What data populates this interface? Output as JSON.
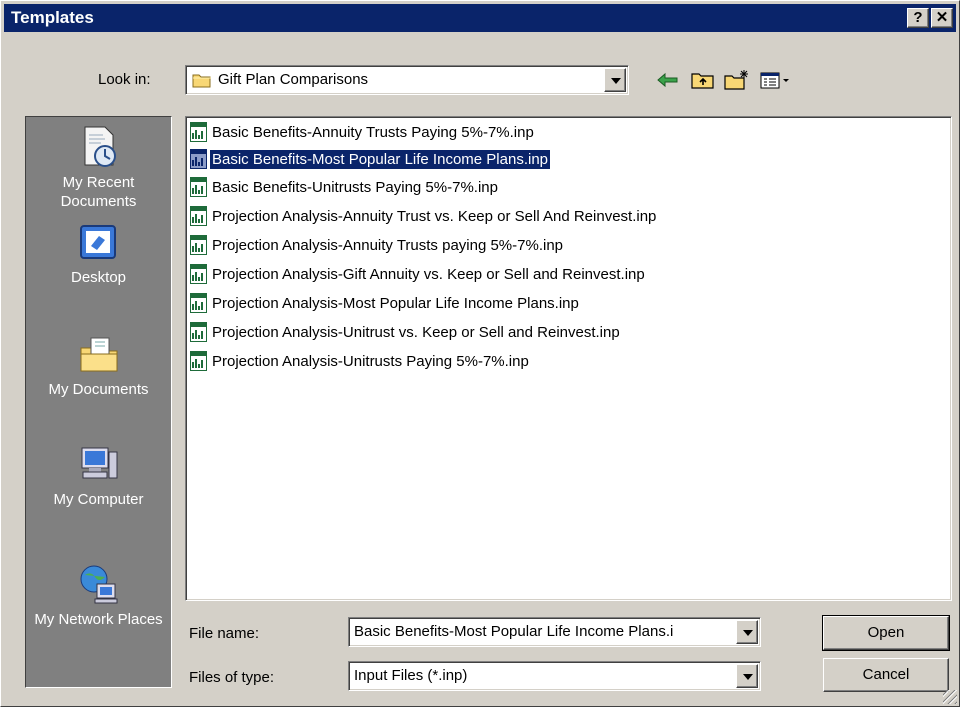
{
  "window": {
    "title": "Templates",
    "help_label": "?",
    "close_label": "✕"
  },
  "look_in": {
    "label": "Look in:",
    "value": "Gift Plan Comparisons"
  },
  "toolbar": {
    "icons": [
      "back-icon",
      "up-folder-icon",
      "new-folder-icon",
      "views-menu-icon"
    ]
  },
  "places": [
    {
      "label": "My Recent Documents",
      "icon": "recent-documents-icon"
    },
    {
      "label": "Desktop",
      "icon": "desktop-icon"
    },
    {
      "label": "My Documents",
      "icon": "my-documents-icon"
    },
    {
      "label": "My Computer",
      "icon": "my-computer-icon"
    },
    {
      "label": "My Network Places",
      "icon": "network-places-icon"
    }
  ],
  "files": [
    {
      "name": "Basic Benefits-Annuity Trusts Paying 5%-7%.inp",
      "selected": false
    },
    {
      "name": "Basic Benefits-Most Popular Life Income Plans.inp",
      "selected": true
    },
    {
      "name": "Basic Benefits-Unitrusts Paying 5%-7%.inp",
      "selected": false
    },
    {
      "name": "Projection Analysis-Annuity Trust vs. Keep or Sell And Reinvest.inp",
      "selected": false
    },
    {
      "name": "Projection Analysis-Annuity Trusts paying 5%-7%.inp",
      "selected": false
    },
    {
      "name": "Projection Analysis-Gift Annuity vs. Keep or Sell and Reinvest.inp",
      "selected": false
    },
    {
      "name": "Projection Analysis-Most Popular Life Income Plans.inp",
      "selected": false
    },
    {
      "name": "Projection Analysis-Unitrust vs. Keep or Sell and Reinvest.inp",
      "selected": false
    },
    {
      "name": "Projection Analysis-Unitrusts Paying 5%-7%.inp",
      "selected": false
    }
  ],
  "file_name": {
    "label": "File name:",
    "value": "Basic Benefits-Most Popular Life Income Plans.i"
  },
  "file_type": {
    "label": "Files of type:",
    "value": "Input Files (*.inp)"
  },
  "buttons": {
    "open": "Open",
    "cancel": "Cancel"
  },
  "colors": {
    "titlebar": "#0a246a",
    "face": "#d4d0c8",
    "places_bg": "#808080",
    "selection": "#0a246a"
  }
}
